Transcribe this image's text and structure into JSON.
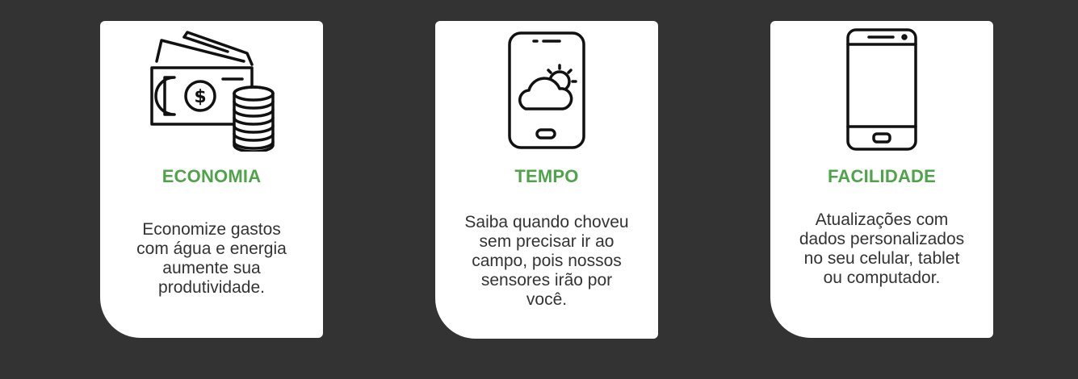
{
  "colors": {
    "background": "#333333",
    "card": "#ffffff",
    "title": "#4fa34a",
    "text": "#333333"
  },
  "cards": [
    {
      "icon": "money-coins-icon",
      "title": "ECONOMIA",
      "description": "Economize gastos\ncom água e energia\naumente sua\nprodutividade."
    },
    {
      "icon": "phone-weather-icon",
      "title": "TEMPO",
      "description": "Saiba quando  choveu\nsem precisar ir ao\ncampo, pois nossos\nsensores irão por\nvocê."
    },
    {
      "icon": "smartphone-icon",
      "title": "FACILIDADE",
      "description": "Atualizações com\ndados personalizados\nno seu celular, tablet\nou computador."
    }
  ]
}
